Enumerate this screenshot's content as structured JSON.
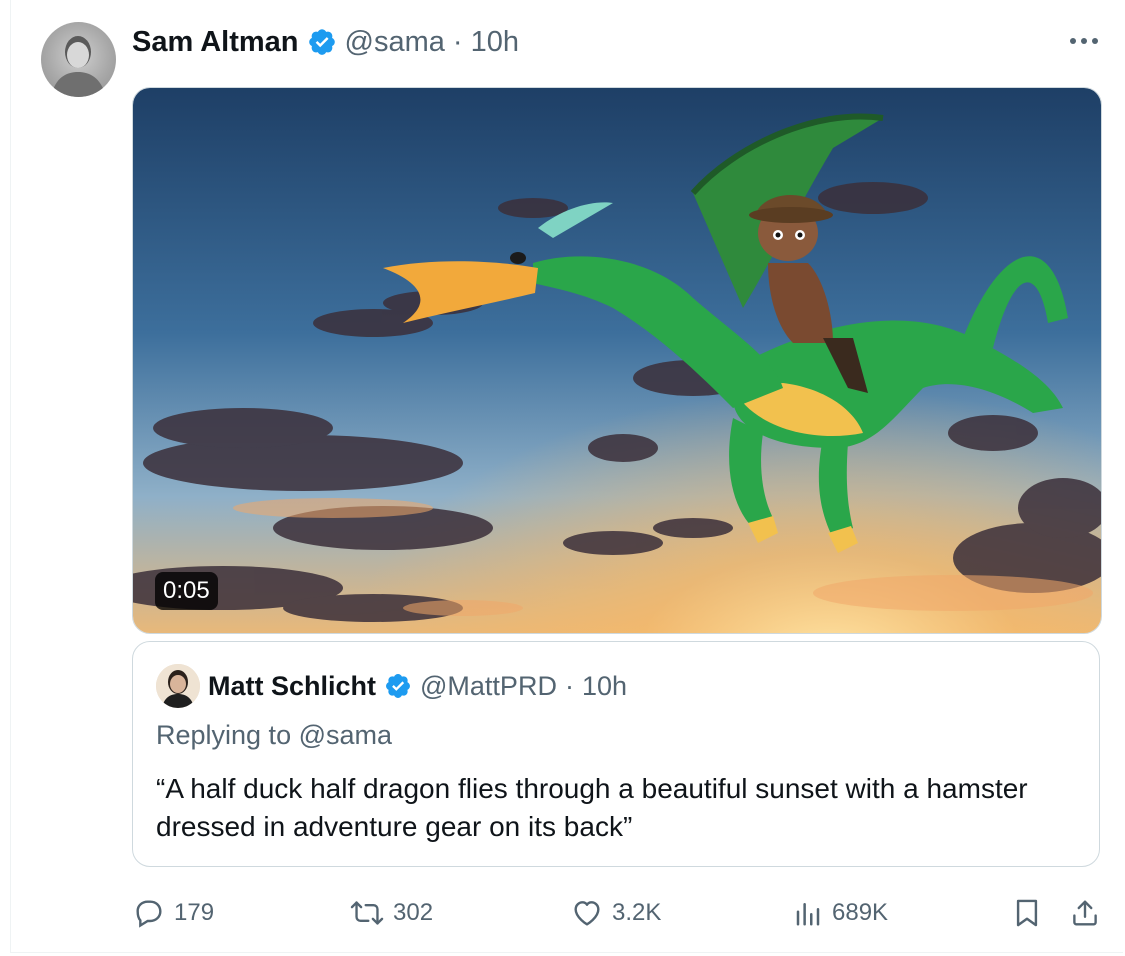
{
  "tweet": {
    "author_name": "Sam Altman",
    "handle": "@sama",
    "separator": "·",
    "time": "10h",
    "more_icon": "more-icon",
    "video_duration": "0:05"
  },
  "quote": {
    "author_name": "Matt Schlicht",
    "handle": "@MattPRD",
    "separator": "·",
    "time": "10h",
    "replying_to": "Replying to @sama",
    "text": "“A half duck half dragon flies through a beautiful sunset with a hamster dressed in adventure gear on its back”"
  },
  "actions": {
    "replies": "179",
    "retweets": "302",
    "likes": "3.2K",
    "views": "689K"
  },
  "colors": {
    "verified": "#1d9bf0",
    "muted": "#536471",
    "border": "#cfd9de"
  }
}
